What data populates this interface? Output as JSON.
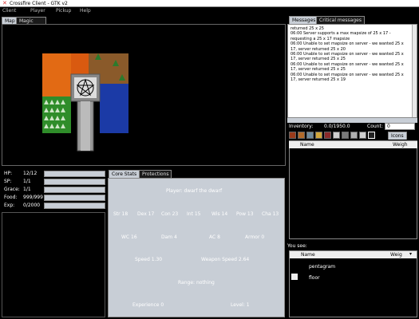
{
  "window": {
    "title": "Crossfire Client - GTK v2"
  },
  "menu": [
    "Client",
    "Player",
    "Pickup",
    "Help"
  ],
  "map_tabs": [
    "Map",
    "Magic Map"
  ],
  "message_tabs": [
    "Messages",
    "Critical messages"
  ],
  "messages": [
    "returned 25 x 25",
    "06:00 Server supports a max mapsize of 25 x 17 - requesting a 25 x 17 mapsize",
    "06:00 Unable to set mapsize on server - we wanted 25 x 17, server returned 25 x 20",
    "06:00 Unable to set mapsize on server - we wanted 25 x 17, server returned 25 x 25",
    "06:00 Unable to set mapsize on server - we wanted 25 x 17, server returned 25 x 25",
    "06:00 Unable to set mapsize on server - we wanted 25 x 17, server returned 25 x 19"
  ],
  "inventory": {
    "label": "Inventory:",
    "weight": "0.0/1950.0",
    "count_label": "Count:",
    "count_value": "0",
    "icons_tab_label": "Icons",
    "columns": [
      "Name",
      "Weigh"
    ]
  },
  "you_see": {
    "label": "You see:",
    "columns": [
      "Name",
      "Weig"
    ],
    "items": [
      "pentagram",
      "floor"
    ]
  },
  "stats": [
    {
      "label": "HP:",
      "value": "12/12",
      "fill": 1.0
    },
    {
      "label": "SP:",
      "value": "1/1",
      "fill": 1.0
    },
    {
      "label": "Grace:",
      "value": "1/1",
      "fill": 1.0
    },
    {
      "label": "Food:",
      "value": "999/999",
      "fill": 1.0
    },
    {
      "label": "Exp:",
      "value": "0/2000",
      "fill": 0.0
    }
  ],
  "core_tabs": [
    "Core Stats",
    "Protections"
  ],
  "core": {
    "player": "Player: dwarf the dwarf",
    "attrs": [
      "Str 18",
      "Dex 17",
      "Con 23",
      "Int 15",
      "Wis 14",
      "Pow 13",
      "Cha 13"
    ],
    "wc": "WC 16",
    "dam": "Dam 4",
    "ac": "AC 8",
    "armor": "Armor 0",
    "speed": "Speed 1.30",
    "weapon_speed": "Weapon Speed 2.64",
    "range": "Range: nothing",
    "experience": "Experience 0",
    "level": "Level: 1"
  },
  "colors": {
    "lava": "#e26a14",
    "grass": "#2f8d2a",
    "water": "#1b3aa6",
    "dirt": "#8a5a2a",
    "panel": "#c8ced6"
  }
}
